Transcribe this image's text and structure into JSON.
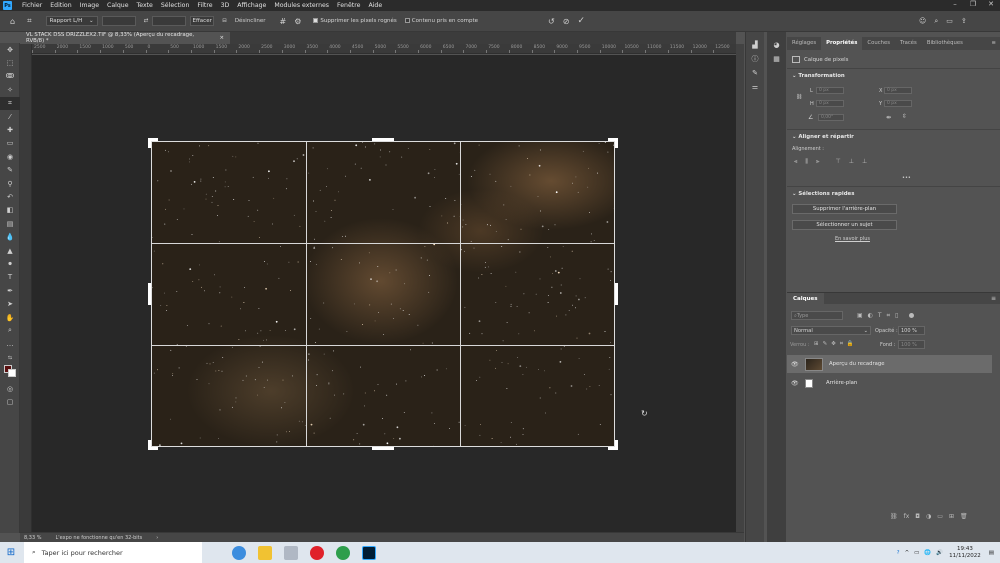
{
  "menubar": {
    "logo": "Ps",
    "items": [
      "Fichier",
      "Edition",
      "Image",
      "Calque",
      "Texte",
      "Sélection",
      "Filtre",
      "3D",
      "Affichage",
      "Modules externes",
      "Fenêtre",
      "Aide"
    ]
  },
  "optionsbar": {
    "ratio": "Rapport L/H",
    "clear": "Effacer",
    "straighten": "Désincliner",
    "delete_cropped": "Supprimer les pixels rognés",
    "content_aware": "Contenu pris en compte"
  },
  "document": {
    "tab_title": "VL STACK DSS DRIZZLEX2.TIF @ 8,33% (Aperçu du recadrage, RVB/8) *",
    "tab_close": "×"
  },
  "ruler": {
    "h_labels": [
      "2500",
      "2000",
      "1500",
      "1000",
      "500",
      "0",
      "500",
      "1000",
      "1500",
      "2000",
      "2500",
      "3000",
      "3500",
      "4000",
      "4500",
      "5000",
      "5500",
      "6000",
      "6500",
      "7000",
      "7500",
      "8000",
      "8500",
      "9000",
      "9500",
      "10000",
      "10500",
      "11000",
      "11500",
      "12000",
      "12500"
    ]
  },
  "statusbar": {
    "zoom": "8,33 %",
    "message": "L'expo ne fonctionne qu'en 32-bits"
  },
  "properties": {
    "tabs": [
      "Réglages",
      "Propriétés",
      "Couches",
      "Tracés",
      "Bibliothèques"
    ],
    "active_tab": "Propriétés",
    "layer_type": "Calque de pixels",
    "transform_title": "Transformation",
    "w_label": "L",
    "w_value": "0 px",
    "x_label": "X",
    "x_value": "0 px",
    "h_label": "H",
    "h_value": "0 px",
    "y_label": "Y",
    "y_value": "0 px",
    "angle_value": "0,00°",
    "align_title": "Aligner et répartir",
    "align_label": "Alignement :",
    "more": "•••",
    "quick_title": "Sélections rapides",
    "btn_remove_bg": "Supprimer l'arrière-plan",
    "btn_select_subject": "Sélectionner un sujet",
    "learn_more": "En savoir plus"
  },
  "layers": {
    "tab": "Calques",
    "search_placeholder": "Type",
    "blend_mode": "Normal",
    "opacity_label": "Opacité :",
    "opacity_value": "100 %",
    "lock_label": "Verrou :",
    "fill_label": "Fond :",
    "fill_value": "100 %",
    "items": [
      {
        "name": "Aperçu du recadrage",
        "selected": true
      },
      {
        "name": "Arrière-plan",
        "selected": false
      }
    ]
  },
  "taskbar": {
    "search_placeholder": "Taper ici pour rechercher",
    "time": "19:43",
    "date": "11/11/2022"
  },
  "colors": {
    "accent": "#31a8ff",
    "canvas_bg": "#282828",
    "panel_bg": "#535353"
  }
}
